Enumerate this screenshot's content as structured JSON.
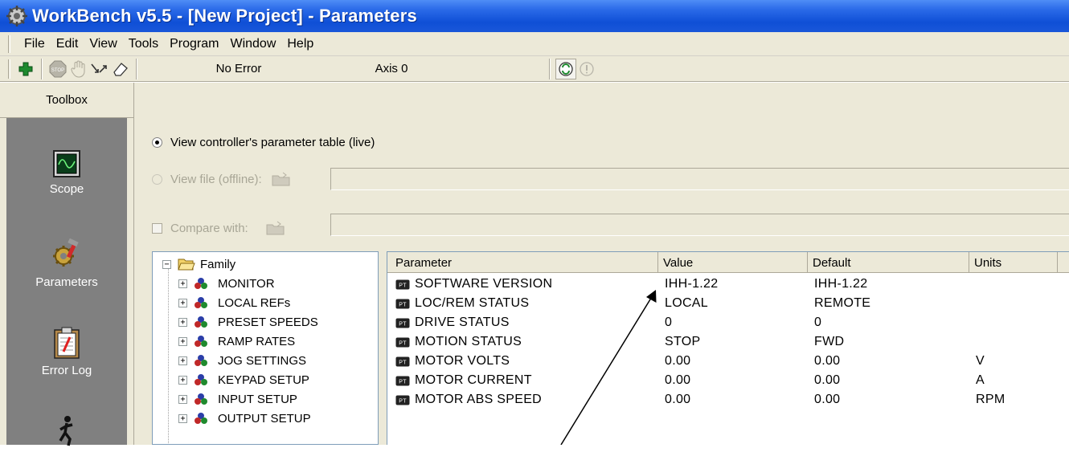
{
  "window": {
    "title": "WorkBench v5.5 - [New Project] - Parameters"
  },
  "menu": {
    "items": [
      "File",
      "Edit",
      "View",
      "Tools",
      "Program",
      "Window",
      "Help"
    ]
  },
  "toolbar": {
    "status": "No Error",
    "axis": "Axis 0",
    "icons": [
      "add-icon",
      "stop-icon",
      "hand-icon",
      "arrows-icon",
      "eraser-icon",
      "sync-icon",
      "warning-icon"
    ]
  },
  "toolbox": {
    "header": "Toolbox",
    "tools": [
      {
        "label": "Scope",
        "icon": "scope-icon"
      },
      {
        "label": "Parameters",
        "icon": "parameters-icon"
      },
      {
        "label": "Error Log",
        "icon": "error-log-icon"
      },
      {
        "label": "",
        "icon": "run-icon"
      }
    ]
  },
  "source": {
    "live_label": "View controller's parameter table (live)",
    "offline_label": "View file (offline):",
    "offline_value": "",
    "compare_label": "Compare with:",
    "compare_value": "",
    "selected": "live"
  },
  "tree": {
    "root": "Family",
    "items": [
      "MONITOR",
      "LOCAL REFs",
      "PRESET SPEEDS",
      "RAMP RATES",
      "JOG SETTINGS",
      "KEYPAD SETUP",
      "INPUT SETUP",
      "OUTPUT SETUP"
    ]
  },
  "table": {
    "columns": [
      "Parameter",
      "Value",
      "Default",
      "Units"
    ],
    "rows": [
      {
        "parameter": "SOFTWARE VERSION",
        "value": "IHH-1.22",
        "default": "IHH-1.22",
        "units": ""
      },
      {
        "parameter": "LOC/REM STATUS",
        "value": "LOCAL",
        "default": "REMOTE",
        "units": ""
      },
      {
        "parameter": "DRIVE STATUS",
        "value": "0",
        "default": "0",
        "units": ""
      },
      {
        "parameter": "MOTION STATUS",
        "value": "STOP",
        "default": "FWD",
        "units": ""
      },
      {
        "parameter": "MOTOR VOLTS",
        "value": "0.00",
        "default": "0.00",
        "units": "V"
      },
      {
        "parameter": "MOTOR CURRENT",
        "value": "0.00",
        "default": "0.00",
        "units": "A"
      },
      {
        "parameter": "MOTOR ABS SPEED",
        "value": "0.00",
        "default": "0.00",
        "units": "RPM"
      }
    ]
  },
  "colors": {
    "titlebar": "#0f4fd6",
    "chrome": "#ece9d8",
    "toolbox_panel": "#808080"
  }
}
